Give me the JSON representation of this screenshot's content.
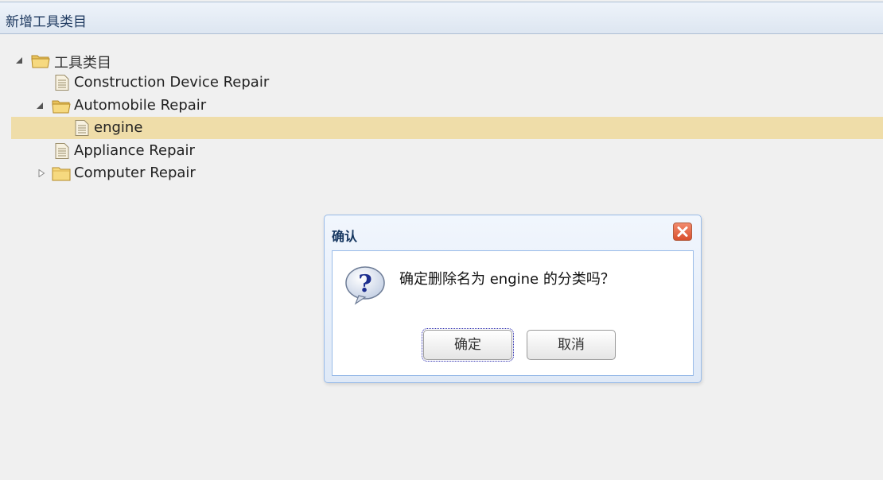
{
  "panel": {
    "title": "新增工具类目"
  },
  "tree": {
    "root": {
      "label": "工具类目",
      "expanded": true,
      "icon": "folder-open-icon"
    },
    "items": [
      {
        "label": "Construction Device Repair",
        "icon": "file-icon"
      },
      {
        "label": "Automobile Repair",
        "icon": "folder-open-icon",
        "expanded": true
      },
      {
        "label": "engine",
        "icon": "file-icon",
        "selected": true
      },
      {
        "label": "Appliance Repair",
        "icon": "file-icon"
      },
      {
        "label": "Computer Repair",
        "icon": "folder-closed-icon",
        "expanded": false
      }
    ]
  },
  "dialog": {
    "title": "确认",
    "message": "确定删除名为 engine 的分类吗？",
    "ok_label": "确定",
    "cancel_label": "取消",
    "icon": "question-icon",
    "close_icon": "close-icon"
  },
  "colors": {
    "selected_row": "#efdda9",
    "header_bg": "#dde6f1",
    "dialog_border": "#99bbe8",
    "close_button": "#d9502d"
  }
}
